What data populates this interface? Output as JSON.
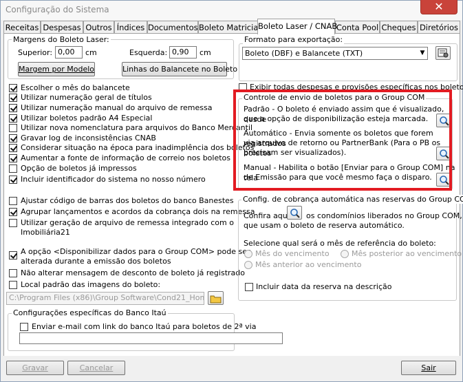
{
  "window": {
    "title": "Configuração do Sistema",
    "close": "✕"
  },
  "tabs": [
    {
      "label": "Receitas"
    },
    {
      "label": "Despesas"
    },
    {
      "label": "Outros"
    },
    {
      "label": "Índices"
    },
    {
      "label": "Documentos"
    },
    {
      "label": "Boleto Matricial"
    },
    {
      "label": "Boleto Laser / CNAB"
    },
    {
      "label": "Conta Pool"
    },
    {
      "label": "Cheques"
    },
    {
      "label": "Diretórios"
    }
  ],
  "margins": {
    "legend": "Margens do Boleto Laser:",
    "superior_label": "Superior:",
    "superior_value": "0,00",
    "superior_unit": "cm",
    "esquerda_label": "Esquerda:",
    "esquerda_value": "0,90",
    "esquerda_unit": "cm",
    "btn_model": "Margem por Modelo",
    "btn_lines": "Linhas do Balancete no Boleto"
  },
  "export": {
    "legend": "Formato para exportação:",
    "selected": "Boleto (DBF) e Balancete (TXT)",
    "show_all_label": "Exibir todas despesas e provisões específicas nos boletos"
  },
  "options1": [
    {
      "label": "Escolher o mês do balancete",
      "checked": true
    },
    {
      "label": "Utilizar numeração geral de títulos",
      "checked": true
    },
    {
      "label": "Utilizar numeração manual do arquivo de remessa",
      "checked": true
    },
    {
      "label": "Utilizar boletos padrão A4 Especial",
      "checked": true
    },
    {
      "label": "Utilizar nova nomenclatura para arquivos do Banco Mercantil",
      "checked": false
    },
    {
      "label": "Gravar log de inconsistências CNAB",
      "checked": true
    },
    {
      "label": "Considerar situação na época para inadimplência dos boletos",
      "checked": true
    },
    {
      "label": "Aumentar a fonte de informação de correio nos boletos",
      "checked": true
    },
    {
      "label": "Opção de boletos já impressos",
      "checked": false
    },
    {
      "label": "Incluir identificador do sistema no nosso número",
      "checked": true
    }
  ],
  "options2": [
    {
      "label": "Ajustar código de barras dos boletos do banco Banestes",
      "checked": false
    },
    {
      "label": "Agrupar lançamentos e acordos da cobrança dois na remessa",
      "checked": true
    },
    {
      "label1": "Utilizar geração de arquivo de remessa integrado com o",
      "label2": "Imobiliária21",
      "checked": false
    }
  ],
  "options3": {
    "disponibilizar_line1": "A opção <Disponibilizar dados para o Group COM> pode ser",
    "disponibilizar_line2": "alterada durante a emissão dos boletos",
    "disponibilizar_checked": true,
    "desconto": "Não alterar mensagem de desconto de boleto já registrado",
    "local": "Local padrão das imagens do boleto:",
    "path": "C:\\Program Files (x86)\\Group Software\\Cond21_HomolGED"
  },
  "itau": {
    "legend": "Configurações específicas do Banco Itaú",
    "email_label": "Enviar e-mail com link do banco Itaú para boletos de 2ª via",
    "email_value": ""
  },
  "group_com": {
    "legend": "Controle de envio de boletos para o Group COM",
    "padrao1": "Padrão - O boleto é enviado assim que é visualizado, desde",
    "padrao2": "que a opção de disponibilização esteja marcada.",
    "auto1": "Automático - Envia somente os boletos que forem registrados",
    "auto2": "via arquivo de retorno ou PartnerBank (Para o PB os boletos",
    "auto3": "precisam ser visualizados).",
    "manual1": "Manual - Habilita o botão [Enviar para o Group COM] na tela",
    "manual2": "de Emissão para que você mesmo faça o disparo."
  },
  "reserva": {
    "legend": "Config. de cobrança automática nas reservas do Group COM",
    "confira_pre": "Confira aqui",
    "confira_post": "os condomínios liberados no Group COM,",
    "confira_line2": "que usam o boleto de reserva automático.",
    "select_label": "Selecione qual será o mês de referência do boleto:",
    "radio_mes": "Mês do vencimento",
    "radio_posterior": "Mês posterior ao vencimento",
    "radio_anterior": "Mês anterior ao vencimento",
    "incluir_data": "Incluir data da reserva na descrição"
  },
  "footer": {
    "gravar": "Gravar",
    "cancelar": "Cancelar",
    "sair": "Sair"
  },
  "colors": {
    "highlight": "#e21b22",
    "accent": "#0b64b8"
  }
}
